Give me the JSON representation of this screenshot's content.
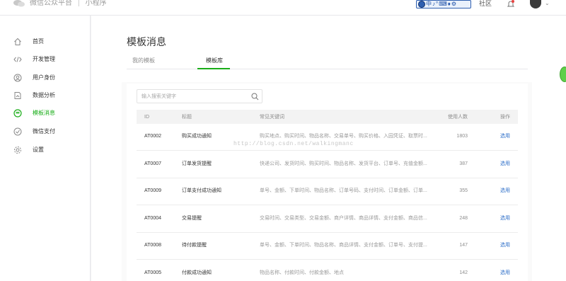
{
  "topbar": {
    "brand_name": "微信公众平台",
    "separator": "|",
    "product": "小程序",
    "ime_glyphs": [
      "中",
      "♪",
      "°",
      "⌨",
      "♦",
      "⚙"
    ],
    "community": "社区",
    "icons": [
      "wechat-logo-icon",
      "bell-icon",
      "avatar",
      "chevron-down-icon"
    ]
  },
  "sidebar": {
    "items": [
      {
        "label": "首页",
        "icon": "home-icon",
        "active": false
      },
      {
        "label": "开发管理",
        "icon": "code-icon",
        "active": false
      },
      {
        "label": "用户身份",
        "icon": "user-icon",
        "active": false
      },
      {
        "label": "数据分析",
        "icon": "chart-icon",
        "active": false
      },
      {
        "label": "模板消息",
        "icon": "message-icon",
        "active": true
      },
      {
        "label": "微信支付",
        "icon": "payment-icon",
        "active": false
      },
      {
        "label": "设置",
        "icon": "gear-icon",
        "active": false
      }
    ]
  },
  "main": {
    "title": "模板消息",
    "tabs": [
      {
        "label": "我的模板",
        "active": false
      },
      {
        "label": "模板库",
        "active": true
      }
    ],
    "search": {
      "placeholder": "输入搜索关键字",
      "value": ""
    },
    "table": {
      "columns": [
        "ID",
        "标题",
        "常见关键词",
        "使用人数",
        "操作"
      ],
      "rows": [
        {
          "id": "AT0002",
          "title": "购买成功通知",
          "keywords": "购买地点、购买时间、物品名称、交易单号、购买价格、入园凭证、取票时...",
          "uses": "1803",
          "action": "选用"
        },
        {
          "id": "AT0007",
          "title": "订单发货提醒",
          "keywords": "快递公司、发货时间、购买时间、物品名称、发货平台、订单号、充值金额...",
          "uses": "387",
          "action": "选用"
        },
        {
          "id": "AT0009",
          "title": "订单支付成功通知",
          "keywords": "单号、金额、下单时间、物品名称、订单号码、支付时间、订单金额、订单...",
          "uses": "355",
          "action": "选用"
        },
        {
          "id": "AT0004",
          "title": "交易提醒",
          "keywords": "交易时间、交易类型、交易金额、商户详情、商品详情、支付金额、商品信...",
          "uses": "248",
          "action": "选用"
        },
        {
          "id": "AT0008",
          "title": "待付款提醒",
          "keywords": "单号、金额、下单时间、物品名称、商品详情、支付金额、订单号、支付提...",
          "uses": "147",
          "action": "选用"
        },
        {
          "id": "AT0005",
          "title": "付款成功通知",
          "keywords": "物品名称、付款时间、付款金额、地点",
          "uses": "142",
          "action": "选用"
        }
      ]
    }
  },
  "watermark": "http://blog.csdn.net/walkingmanc",
  "colors": {
    "accent_green": "#1aad19",
    "link_blue": "#2c6ec8"
  }
}
